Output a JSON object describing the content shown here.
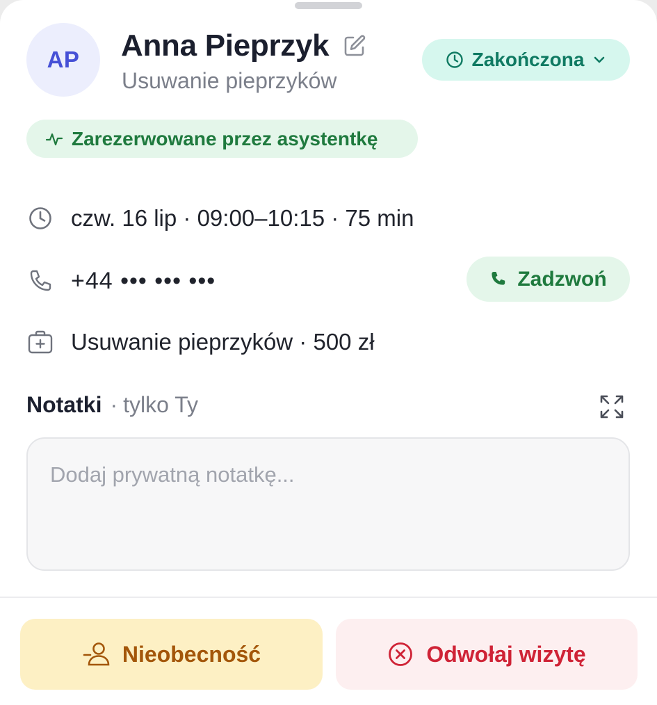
{
  "client": {
    "initials": "AP",
    "name": "Anna Pieprzyk",
    "service": "Usuwanie pieprzyków"
  },
  "status": {
    "label": "Zakończona",
    "icon": "clock-icon",
    "color": "#0f7a62"
  },
  "booking_badge": {
    "label": "Zarezerwowane przez asystentkę",
    "icon": "activity-icon"
  },
  "details": {
    "datetime": "czw. 16 lip · 09:00–10:15 · 75 min",
    "phone": "+44 ••• ••• •••",
    "service_price": "Usuwanie pieprzyków · 500 zł"
  },
  "call_button": {
    "label": "Zadzwoń",
    "icon": "phone-icon"
  },
  "notes": {
    "title": "Notatki",
    "separator": "·",
    "scope": "tylko Ty",
    "placeholder": "Dodaj prywatną notatkę...",
    "value": ""
  },
  "actions": {
    "no_show_label": "Nieobecność",
    "cancel_label": "Odwołaj wizytę"
  },
  "colors": {
    "accent_green": "#1f7a3e",
    "warning": "#a3560a",
    "danger": "#cf2336",
    "avatar_text": "#4650d6"
  }
}
